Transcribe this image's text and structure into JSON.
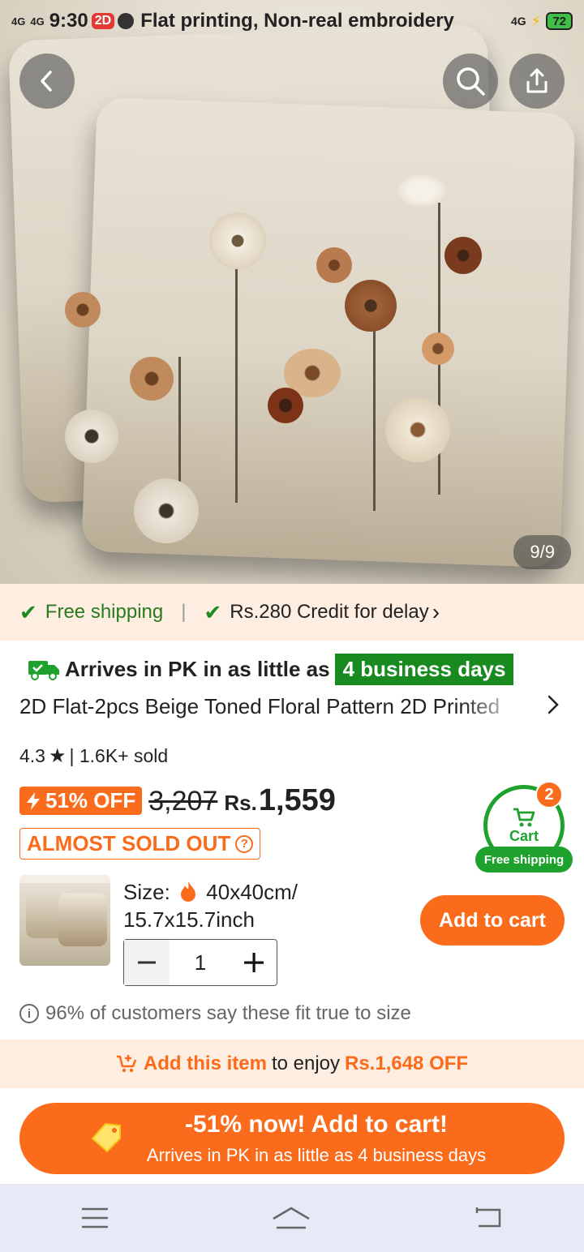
{
  "statusbar": {
    "net1": "4G",
    "net2": "4G",
    "time": "9:30",
    "badge": "2D",
    "title": "Flat printing, Non-real embroidery",
    "net3": "4G",
    "battery": "72"
  },
  "gallery": {
    "pager": "9/9"
  },
  "shipping": {
    "free": "Free shipping",
    "credit": "Rs.280 Credit for delay",
    "chev": "›"
  },
  "arrive": {
    "prefix": "Arrives in PK in as little as",
    "days": "4 business days"
  },
  "product": {
    "title": "2D Flat-2pcs Beige Toned Floral Pattern 2D Printed",
    "rating": "4.3",
    "sold": "| 1.6K+ sold",
    "discount": "51% OFF",
    "old_price": "3,207",
    "currency": "Rs.",
    "price": "1,559",
    "soldout": "ALMOST SOLD OUT"
  },
  "cart": {
    "count": "2",
    "label": "Cart",
    "free": "Free shipping"
  },
  "options": {
    "size_label": "Size:",
    "size_value": "40x40cm/",
    "size_value2": "15.7x15.7inch",
    "qty": "1",
    "add_to_cart": "Add to cart"
  },
  "fit": {
    "text": "96% of customers say these fit true to size"
  },
  "promo": {
    "link": "Add this item",
    "middle": "to enjoy",
    "amount": "Rs.1,648 OFF"
  },
  "cta": {
    "line1": "-51% now! Add to cart!",
    "line2": "Arrives in PK in as little as 4 business days"
  },
  "colors": {
    "accent": "#fa6b1c",
    "green": "#1fa22d",
    "strip": "#fdeee1"
  }
}
